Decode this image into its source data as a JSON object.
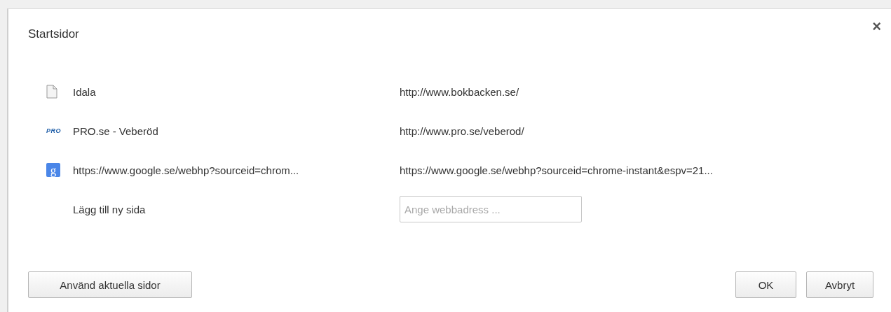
{
  "dialog": {
    "title": "Startsidor",
    "close": "×"
  },
  "pages": [
    {
      "kind": "page",
      "name": "Idala",
      "url": "http://www.bokbacken.se/"
    },
    {
      "kind": "badge",
      "badge": "PRO",
      "name": "PRO.se - Veberöd",
      "url": "http://www.pro.se/veberod/"
    },
    {
      "kind": "tile",
      "badge": "g",
      "name": "https://www.google.se/webhp?sourceid=chrom...",
      "url": "https://www.google.se/webhp?sourceid=chrome-instant&espv=21..."
    }
  ],
  "add_row": {
    "label": "Lägg till ny sida",
    "placeholder": "Ange webbadress ..."
  },
  "buttons": {
    "left": "Använd aktuella sidor",
    "ok": "OK",
    "cancel": "Avbryt"
  }
}
